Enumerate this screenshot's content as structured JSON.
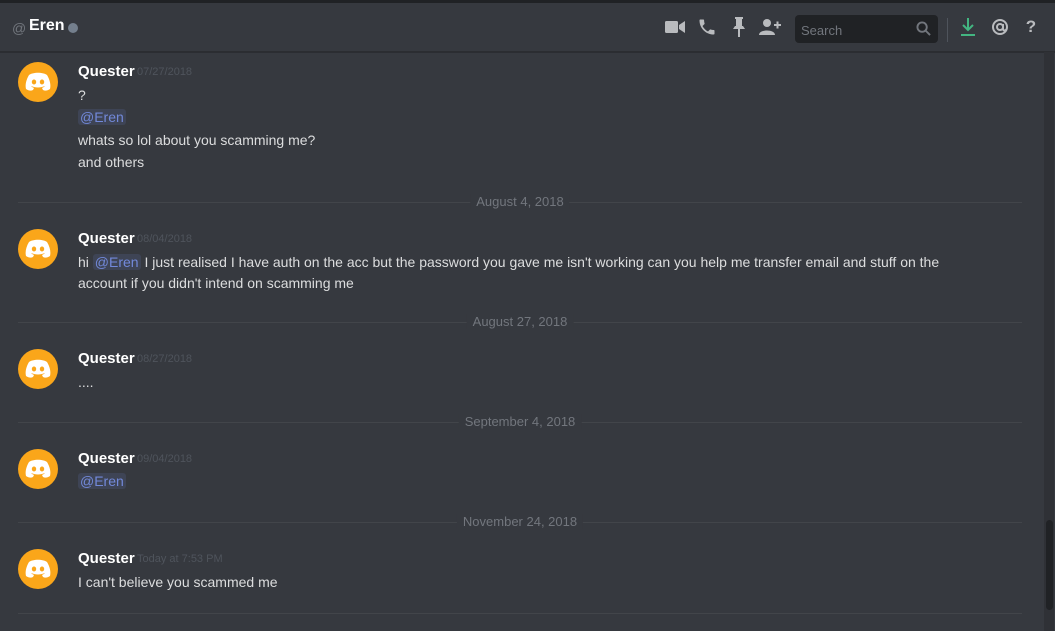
{
  "header": {
    "at_sign": "@",
    "channel_name": "Eren",
    "search_placeholder": "Search"
  },
  "colors": {
    "background": "#36393f",
    "avatar": "#faa61a",
    "mention": "#7289da",
    "download_icon": "#43b581"
  },
  "icons": [
    "video-icon",
    "phone-icon",
    "pin-icon",
    "add-user-icon",
    "search-icon",
    "download-icon",
    "mention-icon",
    "help-icon"
  ],
  "messages": [
    {
      "author": "Quester",
      "timestamp": "07/27/2018",
      "lines": [
        "?",
        "@Eren",
        "whats so lol about you scamming me?",
        "and others"
      ]
    },
    {
      "separator": "August 4, 2018",
      "author": "Quester",
      "timestamp": "08/04/2018",
      "lines": [
        "hi",
        "@Eren",
        "I just realised I have auth on the acc but the password you gave me isn't working can you help me transfer email and stuff on the",
        "account if you didn't intend on scamming me"
      ]
    },
    {
      "separator": "August 27, 2018",
      "author": "Quester",
      "timestamp": "08/27/2018",
      "lines": [
        "...."
      ]
    },
    {
      "separator": "September 4, 2018",
      "author": "Quester",
      "timestamp": "09/04/2018",
      "lines": [
        "@Eren"
      ]
    },
    {
      "separator": "November 24, 2018",
      "author": "Quester",
      "timestamp": "Today at 7:53 PM",
      "lines": [
        "I can't believe you scammed me"
      ]
    }
  ]
}
